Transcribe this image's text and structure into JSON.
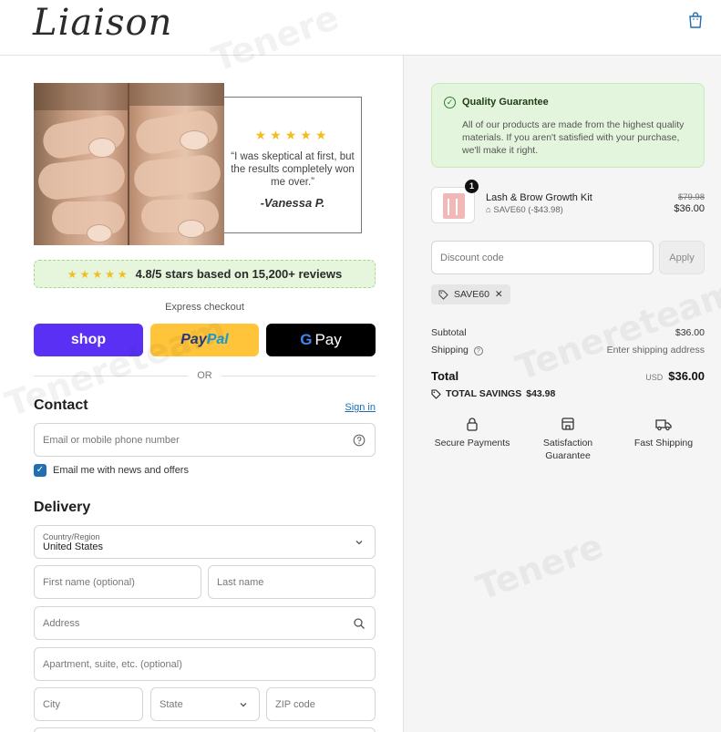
{
  "header": {
    "logo_text": "Liaison",
    "cart_icon": "shopping-bag-icon"
  },
  "testimonial": {
    "stars": "★★★★★",
    "quote": "“I was skeptical at first, but the results completely won me over.”",
    "author": "-Vanessa P."
  },
  "rating": {
    "stars": "★★★★★",
    "text": "4.8/5 stars based on 15,200+ reviews"
  },
  "express": {
    "label": "Express checkout",
    "shop_label": "shop",
    "paypal_pay": "Pay",
    "paypal_pal": "Pal",
    "gpay_g": "G",
    "gpay_label": "Pay",
    "or_label": "OR"
  },
  "contact": {
    "title": "Contact",
    "signin": "Sign in",
    "email_placeholder": "Email or mobile phone number",
    "newsletter_label": "Email me with news and offers",
    "newsletter_checked": true
  },
  "delivery": {
    "title": "Delivery",
    "country_label": "Country/Region",
    "country_value": "United States",
    "first_name_placeholder": "First name (optional)",
    "last_name_placeholder": "Last name",
    "address_placeholder": "Address",
    "apartment_placeholder": "Apartment, suite, etc. (optional)",
    "city_placeholder": "City",
    "state_label": "State",
    "zip_placeholder": "ZIP code"
  },
  "summary": {
    "guarantee_title": "Quality Guarantee",
    "guarantee_body": "All of our products are made from the highest quality materials. If you aren't satisfied with your purchase, we'll make it right.",
    "product": {
      "name": "Lash & Brow Growth Kit",
      "quantity": "1",
      "discount_code": "SAVE60 (-$43.98)",
      "price_original": "$79.98",
      "price_final": "$36.00"
    },
    "discount_placeholder": "Discount code",
    "apply_label": "Apply",
    "applied_code": "SAVE60",
    "subtotal_label": "Subtotal",
    "subtotal_value": "$36.00",
    "shipping_label": "Shipping",
    "shipping_value": "Enter shipping address",
    "total_label": "Total",
    "total_currency": "USD",
    "total_value": "$36.00",
    "savings_label": "TOTAL SAVINGS",
    "savings_value": "$43.98",
    "features": [
      {
        "label": "Secure Payments"
      },
      {
        "label": "Satisfaction Guarantee"
      },
      {
        "label": "Fast Shipping"
      }
    ]
  },
  "colors": {
    "shop_purple": "#5a31f4",
    "paypal_yellow": "#ffc439",
    "guarantee_green": "#e3f5dc",
    "link_blue": "#1f6fb2"
  }
}
